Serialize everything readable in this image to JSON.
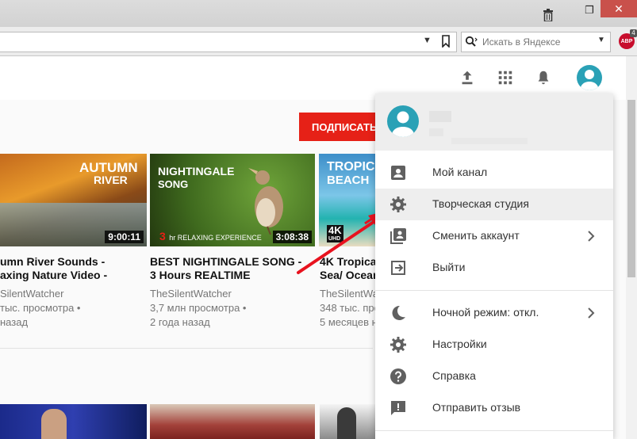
{
  "browser": {
    "search_placeholder": "Искать в Яндексе",
    "adblock_label": "ABP",
    "adblock_count": "4",
    "close_glyph": "✕",
    "restore_glyph": "❐"
  },
  "page": {
    "subscribe_label": "ПОДПИСАТЬ"
  },
  "videos": [
    {
      "thumb_title_line1": "AUTUMN",
      "thumb_title_line2": "RIVER",
      "duration": "9:00:11",
      "title_line1": "umn River Sounds -",
      "title_line2": "axing Nature Video -",
      "channel": "SilentWatcher",
      "views": "тыс. просмотра •",
      "age": "назад"
    },
    {
      "thumb_title_line1": "NIGHTINGALE",
      "thumb_title_line2": "SONG",
      "thumb_sub_big": "3",
      "thumb_sub_rest": "hr  RELAXING EXPERIENCE",
      "duration": "3:08:38",
      "title_line1": "BEST NIGHTINGALE SONG -",
      "title_line2": "3 Hours REALTIME",
      "channel": "TheSilentWatcher",
      "views": "3,7 млн просмотра •",
      "age": "2 года назад"
    },
    {
      "thumb_title_line1": "TROPIC",
      "thumb_title_line2": "BEACH",
      "thumb_badge": "4K",
      "thumb_badge_sub": "UHD",
      "title_line1": "4K Tropical",
      "title_line2": "Sea/ Ocean",
      "channel": "TheSilentWat",
      "views": "348 тыс. про",
      "age": "5 месяцев на"
    }
  ],
  "menu": {
    "items": [
      {
        "label": "Мой канал",
        "icon": "account-box-icon"
      },
      {
        "label": "Творческая студия",
        "icon": "gear-icon"
      },
      {
        "label": "Сменить аккаунт",
        "icon": "switch-account-icon"
      },
      {
        "label": "Выйти",
        "icon": "sign-out-icon"
      },
      {
        "label": "Ночной режим: откл.",
        "icon": "moon-icon"
      },
      {
        "label": "Настройки",
        "icon": "gear-icon"
      },
      {
        "label": "Справка",
        "icon": "help-icon"
      },
      {
        "label": "Отправить отзыв",
        "icon": "feedback-icon"
      }
    ]
  },
  "colors": {
    "subscribe_red": "#e62117",
    "avatar_teal": "#2aa1b6",
    "annotation_arrow": "#e8121e"
  }
}
